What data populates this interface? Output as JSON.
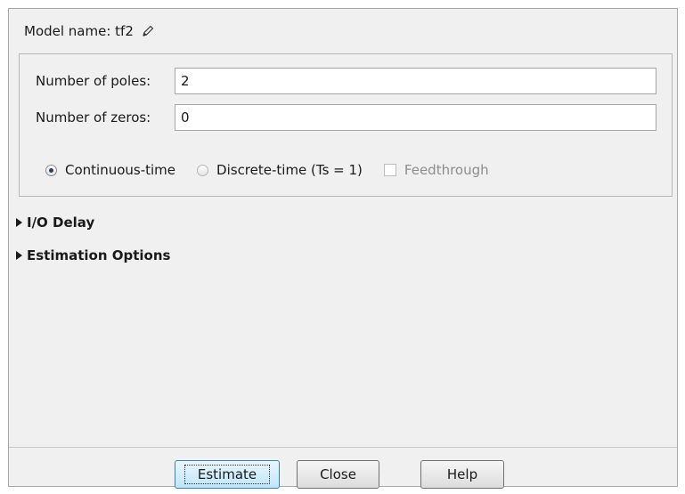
{
  "model": {
    "label": "Model name: tf2",
    "edit_icon": "pencil-icon"
  },
  "params": {
    "poles_label": "Number of poles:",
    "poles_value": "2",
    "zeros_label": "Number of zeros:",
    "zeros_value": "0"
  },
  "options": {
    "continuous_label": "Continuous-time",
    "continuous_selected": true,
    "discrete_label": "Discrete-time (Ts = 1)",
    "discrete_selected": false,
    "feedthrough_label": "Feedthrough",
    "feedthrough_checked": false
  },
  "sections": {
    "io_delay": "I/O Delay",
    "estimation_options": "Estimation Options"
  },
  "buttons": {
    "estimate": "Estimate",
    "close": "Close",
    "help": "Help"
  }
}
